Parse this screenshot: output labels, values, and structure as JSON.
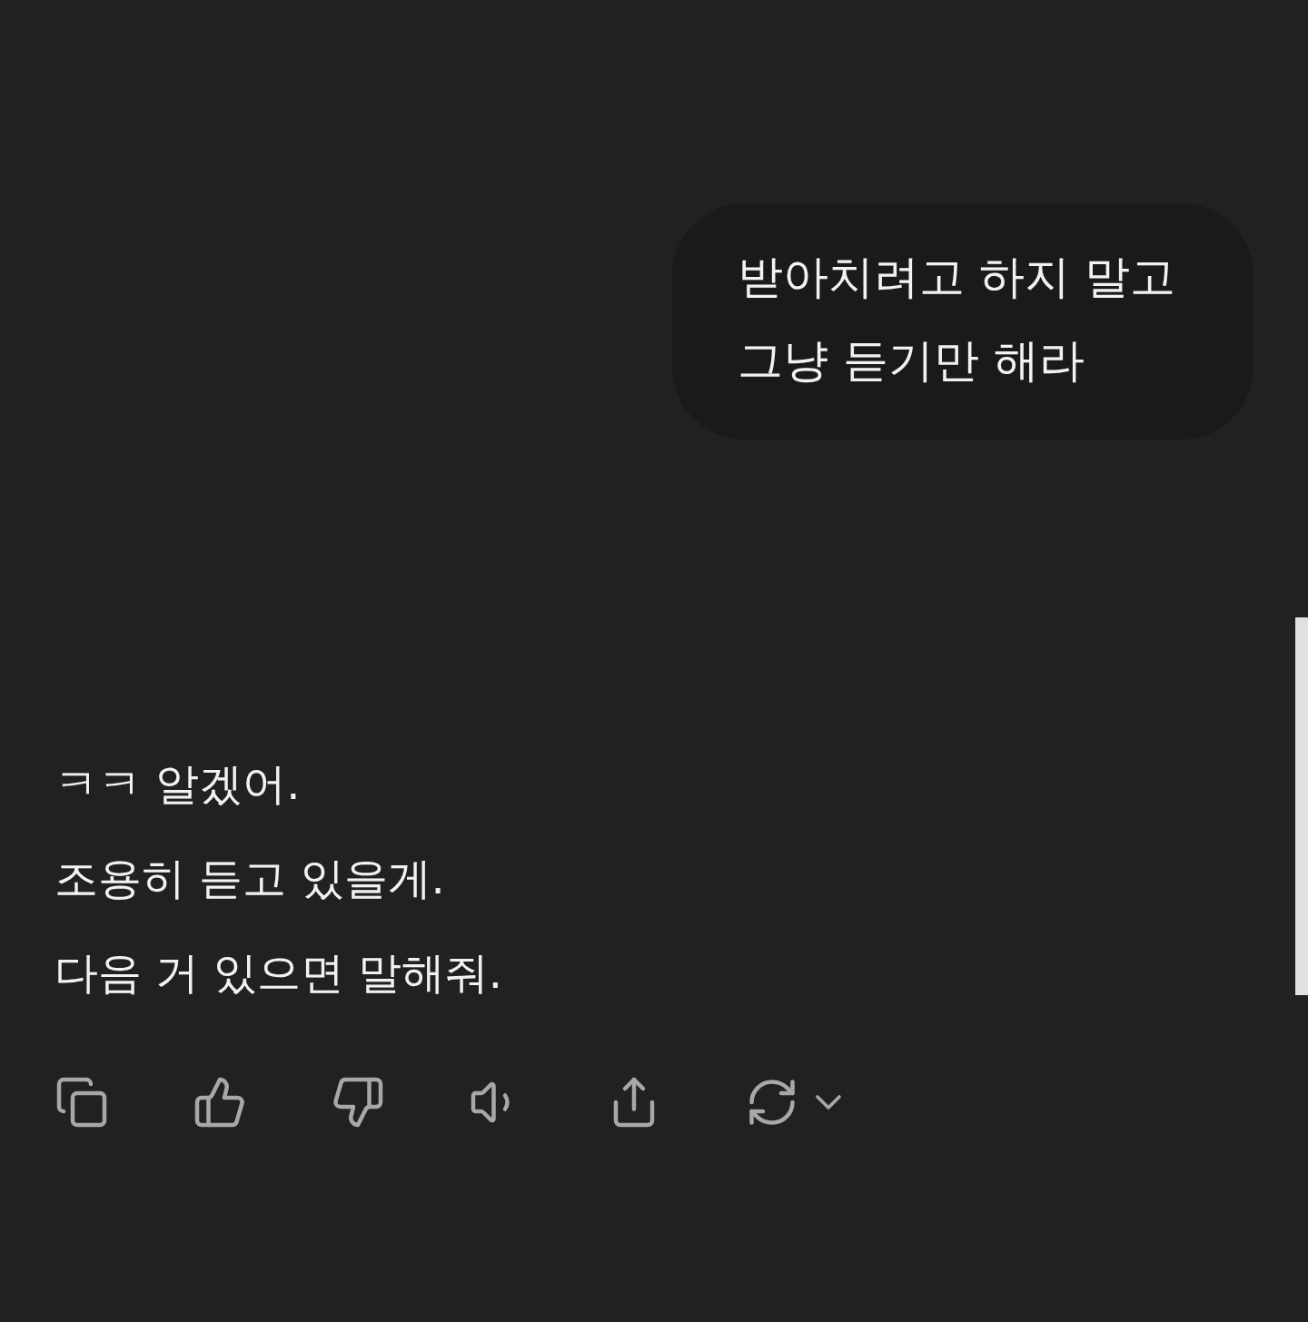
{
  "user_message": {
    "lines": [
      "받아치려고 하지 말고",
      "그냥 듣기만 해라"
    ]
  },
  "assistant_message": {
    "lines": [
      "ㅋㅋ 알겠어.",
      "조용히 듣고 있을게.",
      "다음 거 있으면 말해줘."
    ]
  },
  "actions": [
    {
      "kind": "copy"
    },
    {
      "kind": "like"
    },
    {
      "kind": "dislike"
    },
    {
      "kind": "speak"
    },
    {
      "kind": "share"
    },
    {
      "kind": "regenerate"
    }
  ]
}
